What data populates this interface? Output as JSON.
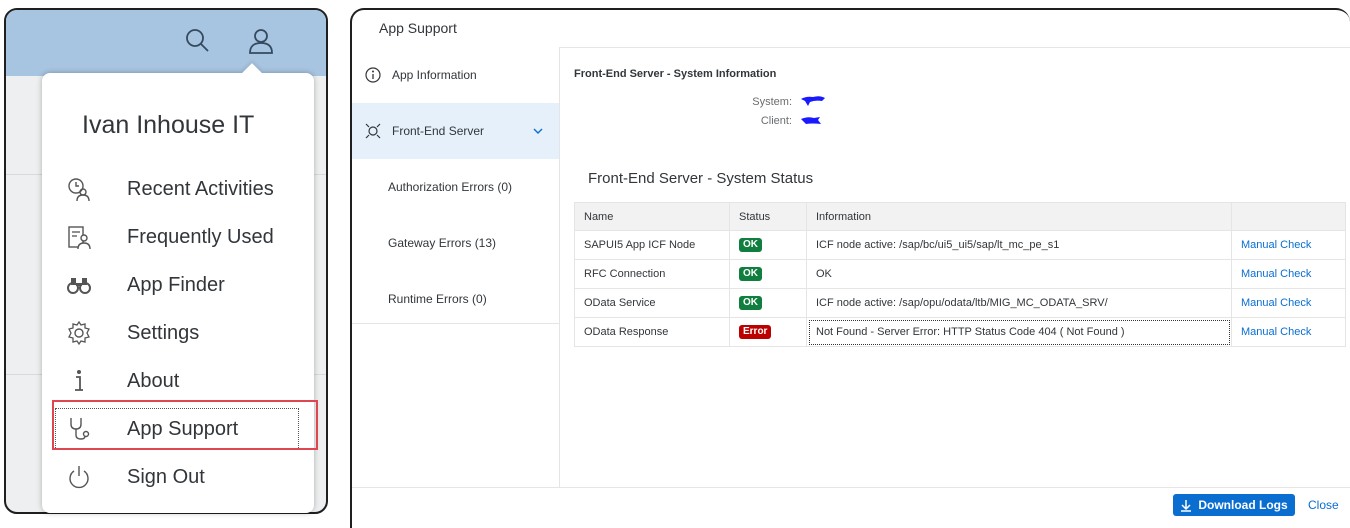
{
  "user_menu": {
    "user_name": "Ivan Inhouse IT",
    "items": [
      {
        "label": "Recent Activities",
        "icon": "recent-activities-icon"
      },
      {
        "label": "Frequently Used",
        "icon": "frequently-used-icon"
      },
      {
        "label": "App Finder",
        "icon": "binoculars-icon"
      },
      {
        "label": "Settings",
        "icon": "settings-gear-icon"
      },
      {
        "label": "About",
        "icon": "info-icon"
      },
      {
        "label": "App Support",
        "icon": "stethoscope-icon"
      },
      {
        "label": "Sign Out",
        "icon": "power-icon"
      }
    ]
  },
  "shell_header": {
    "icons": [
      "search-icon",
      "user-icon"
    ]
  },
  "dialog": {
    "title": "App Support",
    "nav": [
      {
        "label": "App Information",
        "icon": "info-icon"
      },
      {
        "label": "Front-End Server",
        "icon": "server-icon"
      },
      {
        "label": "Authorization Errors (0)"
      },
      {
        "label": "Gateway Errors (13)"
      },
      {
        "label": "Runtime Errors (0)"
      }
    ],
    "section_title": "Front-End Server - System Information",
    "system_label": "System:",
    "client_label": "Client:",
    "status_title": "Front-End Server - System Status",
    "table": {
      "headers": [
        "Name",
        "Status",
        "Information",
        ""
      ],
      "rows": [
        {
          "name": "SAPUI5 App ICF Node",
          "status": "OK",
          "info": "ICF node active: /sap/bc/ui5_ui5/sap/lt_mc_pe_s1",
          "action": "Manual Check"
        },
        {
          "name": "RFC Connection",
          "status": "OK",
          "info": "OK",
          "action": "Manual Check"
        },
        {
          "name": "OData Service",
          "status": "OK",
          "info": "ICF node active: /sap/opu/odata/ltb/MIG_MC_ODATA_SRV/",
          "action": "Manual Check"
        },
        {
          "name": "OData Response",
          "status": "Error",
          "info": "Not Found - Server Error: HTTP Status Code 404 ( Not Found )",
          "action": "Manual Check"
        }
      ]
    },
    "footer": {
      "download_label": "Download Logs",
      "close_label": "Close"
    }
  },
  "colors": {
    "accent": "#0a6ed1",
    "ok": "#107e3e",
    "error": "#bb0000",
    "shell": "#a7c4e0",
    "highlight": "#e0464f"
  }
}
